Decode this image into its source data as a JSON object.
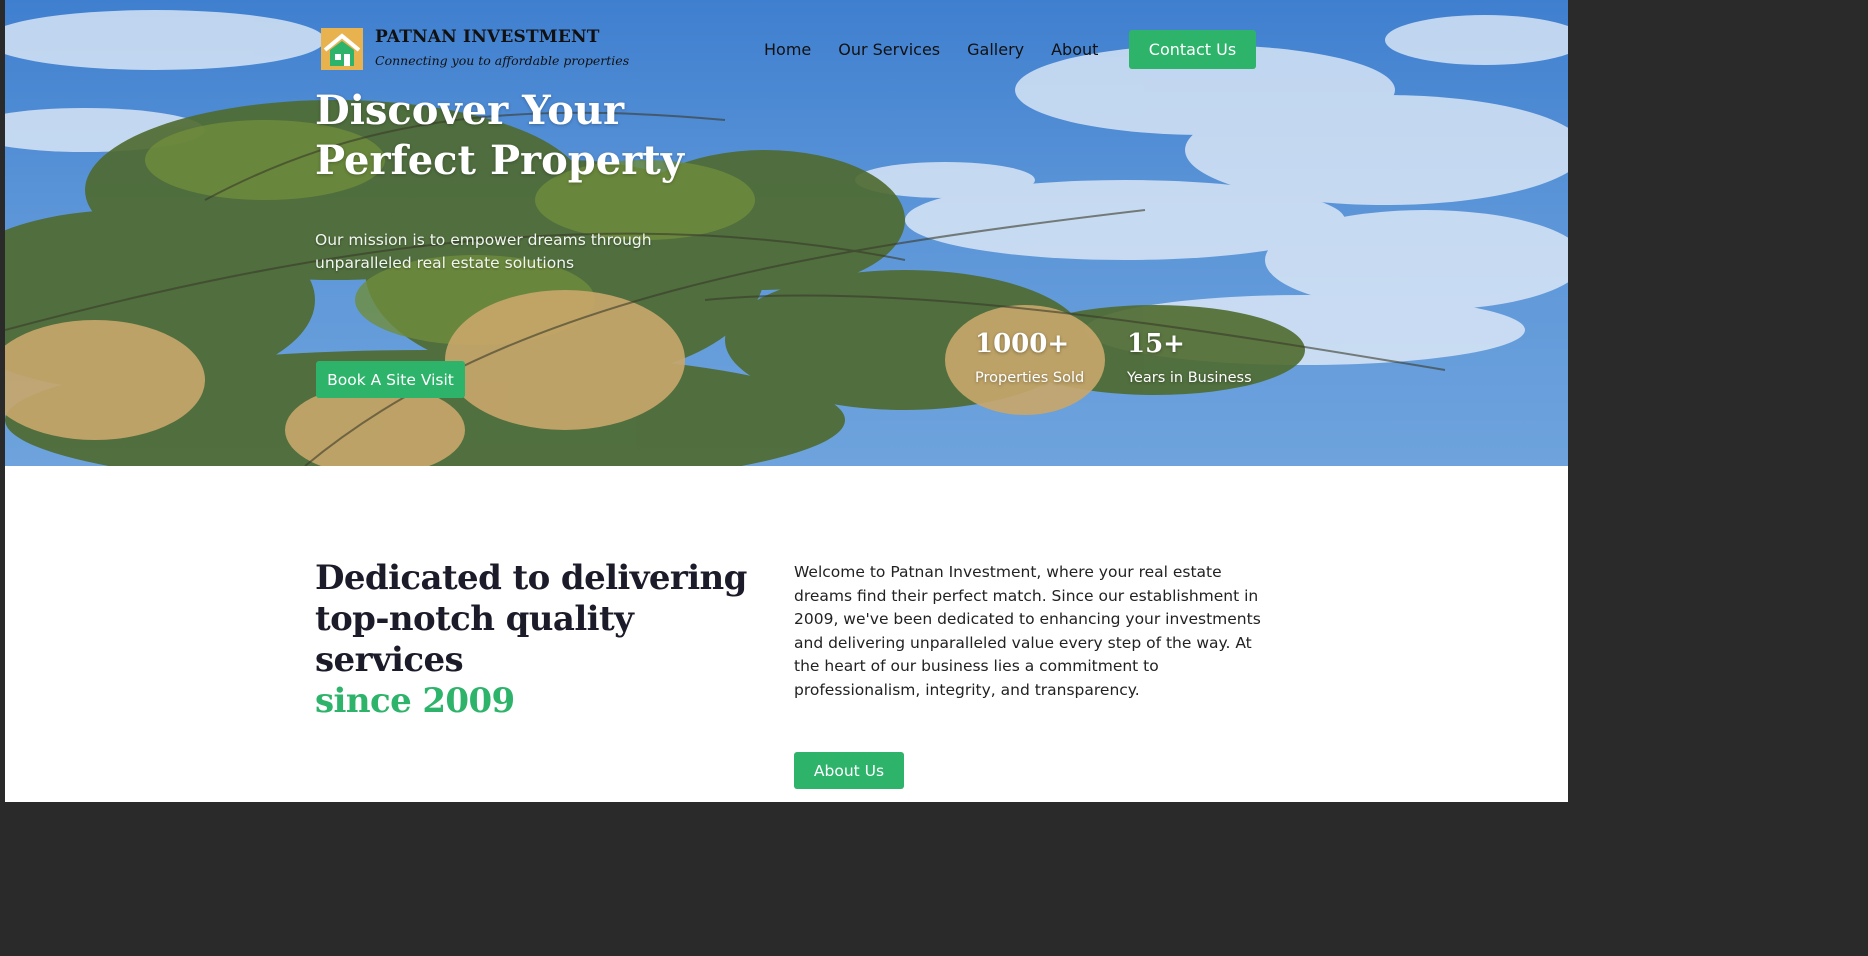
{
  "brand": {
    "name": "PATNAN INVESTMENT",
    "tagline": "Connecting you to affordable properties"
  },
  "nav": {
    "items": [
      "Home",
      "Our Services",
      "Gallery",
      "About"
    ],
    "cta": "Contact Us"
  },
  "hero": {
    "title": "Discover Your Perfect Property",
    "subtitle": "Our mission is to empower dreams through unparalleled real estate solutions",
    "button": "Book A Site Visit",
    "stats": [
      {
        "value": "1000+",
        "label": "Properties Sold"
      },
      {
        "value": "15+",
        "label": "Years in Business"
      }
    ]
  },
  "about": {
    "heading": "Dedicated to delivering top-notch quality services",
    "heading_accent": "since 2009",
    "body": "Welcome to Patnan Investment, where your real estate dreams find their perfect match. Since our establishment in 2009, we've been dedicated to enhancing your investments and delivering unparalleled value every step of the way. At the heart of our business lies a commitment to professionalism, integrity, and transparency.",
    "button": "About Us"
  },
  "colors": {
    "accent": "#2db36a",
    "heading": "#1b1b2a",
    "sky": "#4a88d4"
  },
  "icons": {
    "logo": "house-logo-icon"
  }
}
